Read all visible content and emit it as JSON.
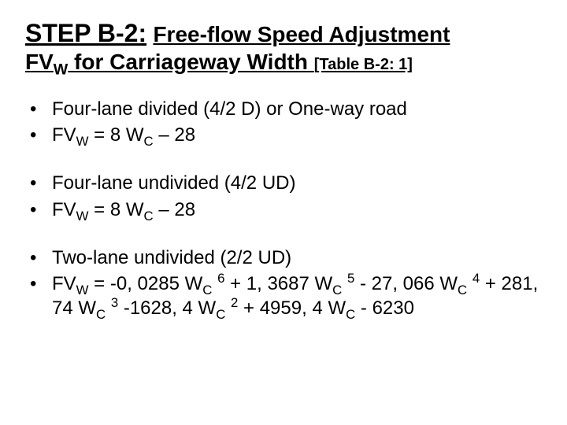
{
  "title": {
    "step": "STEP B-2:",
    "rest": "Free-flow Speed Adjustment",
    "line2_prefix": "FV",
    "line2_sub": "W",
    "line2_mid": " for Carriageway Width ",
    "table_ref": "[Table B-2: 1]"
  },
  "groups": [
    {
      "items": [
        {
          "frags": [
            {
              "t": "Four-lane divided (4/2 D) or One-way road"
            }
          ]
        },
        {
          "frags": [
            {
              "t": "FV"
            },
            {
              "sub": "W"
            },
            {
              "t": " = 8 W"
            },
            {
              "sub": "C"
            },
            {
              "t": " – 28"
            }
          ]
        }
      ]
    },
    {
      "items": [
        {
          "frags": [
            {
              "t": "Four-lane undivided (4/2 UD)"
            }
          ]
        },
        {
          "frags": [
            {
              "t": "FV"
            },
            {
              "sub": "W"
            },
            {
              "t": " = 8 W"
            },
            {
              "sub": "C"
            },
            {
              "t": " – 28"
            }
          ]
        }
      ]
    },
    {
      "items": [
        {
          "frags": [
            {
              "t": "Two-lane undivided (2/2 UD)"
            }
          ]
        },
        {
          "frags": [
            {
              "t": "FV"
            },
            {
              "sub": "W"
            },
            {
              "t": " = -0, 0285 W"
            },
            {
              "sub": "C"
            },
            {
              "t": " "
            },
            {
              "sup": "6"
            },
            {
              "t": " + 1, 3687 W"
            },
            {
              "sub": "C"
            },
            {
              "t": " "
            },
            {
              "sup": "5"
            },
            {
              "t": " - 27, 066 W"
            },
            {
              "sub": "C"
            },
            {
              "t": " "
            },
            {
              "sup": "4"
            },
            {
              "t": " + 281, 74 W"
            },
            {
              "sub": "C"
            },
            {
              "t": " "
            },
            {
              "sup": "3"
            },
            {
              "t": " -1628, 4 W"
            },
            {
              "sub": "C"
            },
            {
              "t": " "
            },
            {
              "sup": "2"
            },
            {
              "t": " + 4959, 4 W"
            },
            {
              "sub": "C"
            },
            {
              "t": " - 6230"
            }
          ]
        }
      ]
    }
  ],
  "bullet_char": "•"
}
